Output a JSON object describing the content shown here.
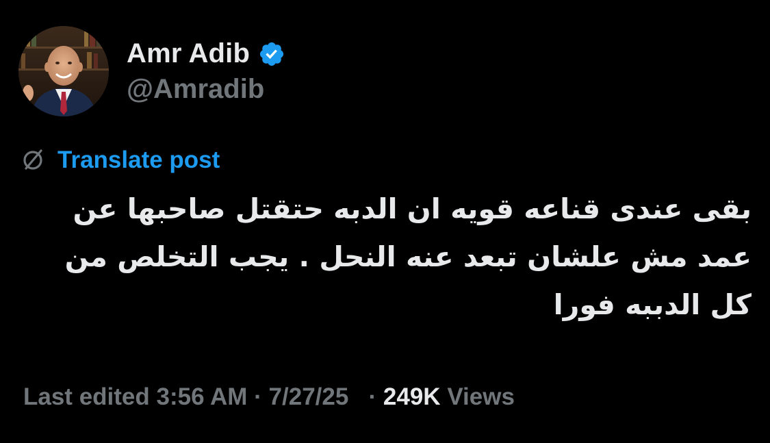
{
  "author": {
    "display_name": "Amr Adib",
    "handle": "@Amradib",
    "verified": true,
    "avatar_icon": "profile-photo"
  },
  "translate": {
    "icon": "globe-slash-icon",
    "label": "Translate post"
  },
  "post": {
    "text": "بقى عندى قناعه قويه ان الدبه حتقتل  صاحبها عن عمد مش علشان تبعد عنه النحل . يجب التخلص من كل الدببه فورا"
  },
  "meta": {
    "edited_label": "Last edited",
    "time": "3:56 AM",
    "separator": "·",
    "date": "7/27/25",
    "views_count": "249K",
    "views_label": "Views"
  },
  "colors": {
    "background": "#000000",
    "primary_text": "#e7e9ea",
    "secondary_text": "#71767b",
    "accent": "#1d9bf0"
  }
}
